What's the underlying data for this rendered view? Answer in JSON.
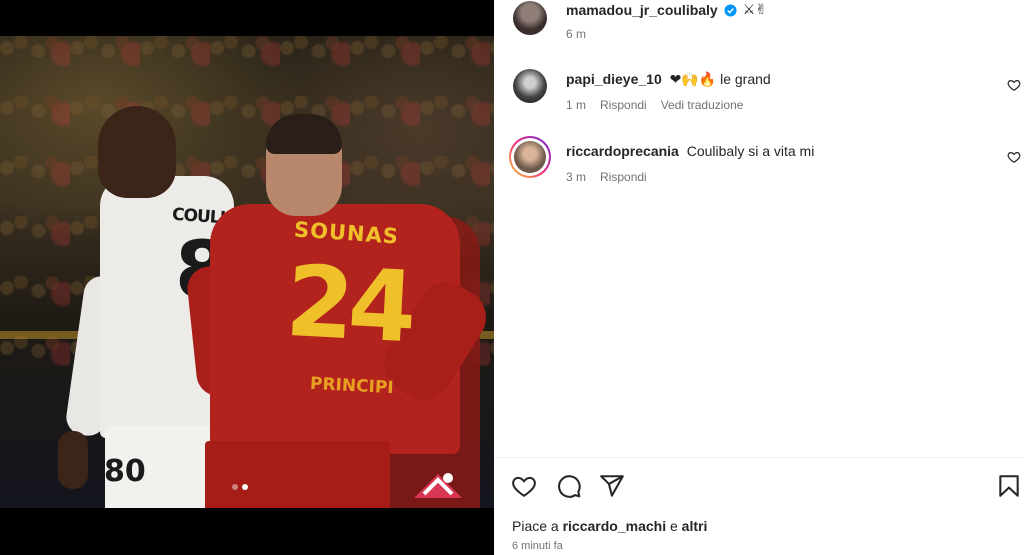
{
  "post": {
    "owner": "mamadou_jr_coulibaly",
    "owner_emoji": "⚔✌",
    "owner_time": "6 m",
    "verified": true
  },
  "photo": {
    "player1_name": "COULIBALY",
    "player1_number": "80",
    "player1_shorts_number": "80",
    "player2_name": "SOUNAS",
    "player2_number": "24",
    "player2_sponsor": "PRINCIPI"
  },
  "comments": [
    {
      "user": "papi_dieye_10",
      "emoji": "❤🙌🔥",
      "text": "le grand",
      "time": "1 m",
      "reply_label": "Rispondi",
      "translate_label": "Vedi traduzione"
    },
    {
      "user": "riccardoprecania",
      "text": "Coulibaly si a vita mi",
      "time": "3 m",
      "reply_label": "Rispondi"
    }
  ],
  "likes": {
    "prefix": "Piace a",
    "user": "riccardo_machi",
    "connector": "e",
    "others": "altri"
  },
  "timestamp": "6 minuti fa",
  "icons": {
    "like": "heart-icon",
    "comment": "comment-icon",
    "share": "share-icon",
    "save": "bookmark-icon",
    "verified": "verified-badge-icon"
  },
  "colors": {
    "verified": "#0095f6",
    "text": "#262626",
    "muted": "#737373",
    "media_bg": "#000000"
  },
  "carousel": {
    "count": 2,
    "active": 2
  }
}
